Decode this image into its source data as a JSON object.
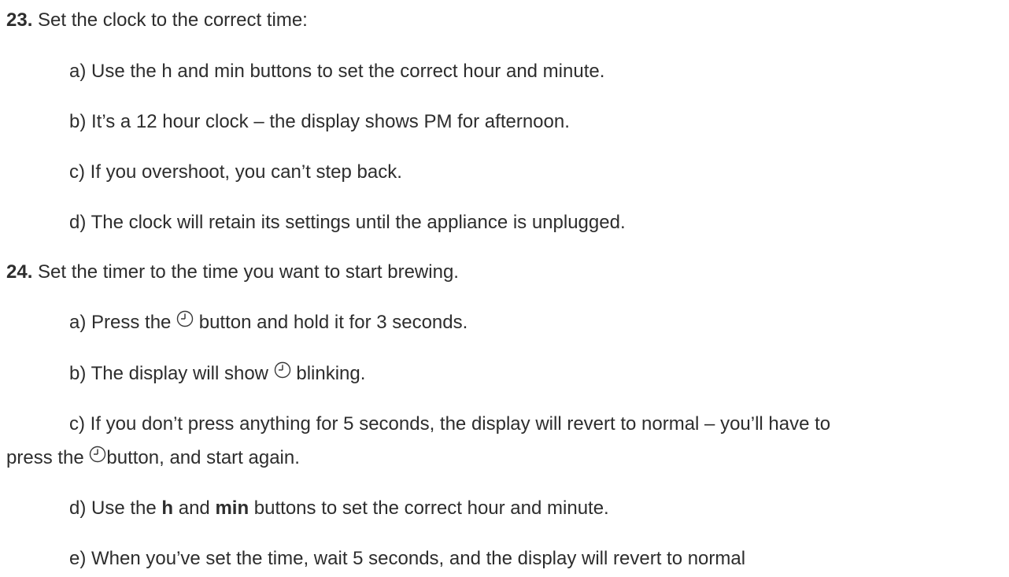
{
  "step23": {
    "number": "23.",
    "text": " Set the clock to the correct time:",
    "items": [
      "a) Use the h and min buttons to set the correct hour and minute.",
      "b) It’s a 12 hour clock – the display shows PM for afternoon.",
      "c) If you overshoot, you can’t step back.",
      "d) The clock will retain its settings until the appliance is unplugged."
    ]
  },
  "step24": {
    "number": "24.",
    "text": " Set the timer to the time you want to start brewing.",
    "a": {
      "before": "a) Press the ",
      "after": " button and hold it for 3 seconds."
    },
    "b": {
      "before": "b) The display will show ",
      "after": " blinking."
    },
    "c": {
      "line1": "c) If you don’t press anything for 5 seconds, the display will revert to normal – you’ll have to",
      "line2_before": "press the ",
      "line2_after": "button, and start again."
    },
    "d": {
      "p1": "d) Use the ",
      "h": "h",
      "p2": " and ",
      "min": "min",
      "p3": " buttons to set the correct hour and minute."
    },
    "e": "e) When you’ve set the time, wait 5 seconds, and the display will revert to normal",
    "icon": "clock-icon"
  }
}
